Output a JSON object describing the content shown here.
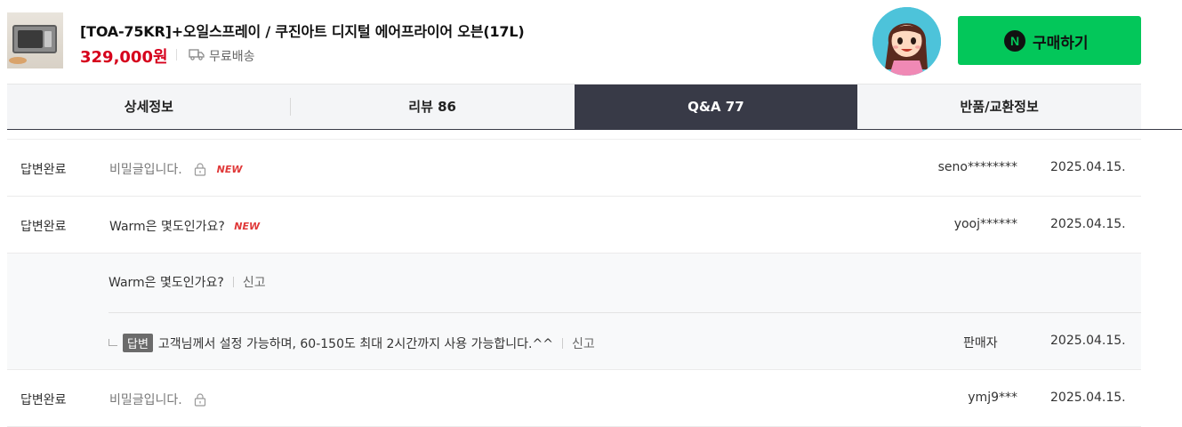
{
  "product": {
    "title": "[TOA-75KR]+오일스프레이 / 쿠진아트 디지털 에어프라이어 오븐(17L)",
    "price": "329,000원",
    "shipping": "무료배송",
    "image": "oven-thumbnail-icon"
  },
  "buy_button": {
    "label": "구매하기",
    "icon": "naver-n-icon",
    "color": "#03c75a"
  },
  "tabs": [
    {
      "label": "상세정보"
    },
    {
      "label": "리뷰 86"
    },
    {
      "label": "Q&A 77",
      "active": true
    },
    {
      "label": "반품/교환정보"
    }
  ],
  "qna": {
    "rows": [
      {
        "status": "답변완료",
        "subject": "비밀글입니다.",
        "secret": true,
        "new": "NEW",
        "writer": "seno********",
        "date": "2025.04.15."
      },
      {
        "status": "답변완료",
        "subject": "Warm은 몇도인가요?",
        "secret": false,
        "new": "NEW",
        "writer": "yooj******",
        "date": "2025.04.15."
      },
      {
        "status": "답변완료",
        "subject": "비밀글입니다.",
        "secret": true,
        "new": "",
        "writer": "ymj9***",
        "date": "2025.04.15."
      }
    ],
    "expanded": {
      "question": "Warm은 몇도인가요?",
      "report_label": "신고",
      "answer_badge": "답변",
      "answer": "고객님께서 설정 가능하며, 60-150도 최대 2시간까지 사용 가능합니다.^^",
      "answer_report_label": "신고",
      "answer_writer": "판매자",
      "answer_date": "2025.04.15."
    }
  },
  "colors": {
    "price": "#d6001c",
    "active_tab": "#383a47",
    "new_badge": "#e03939"
  }
}
